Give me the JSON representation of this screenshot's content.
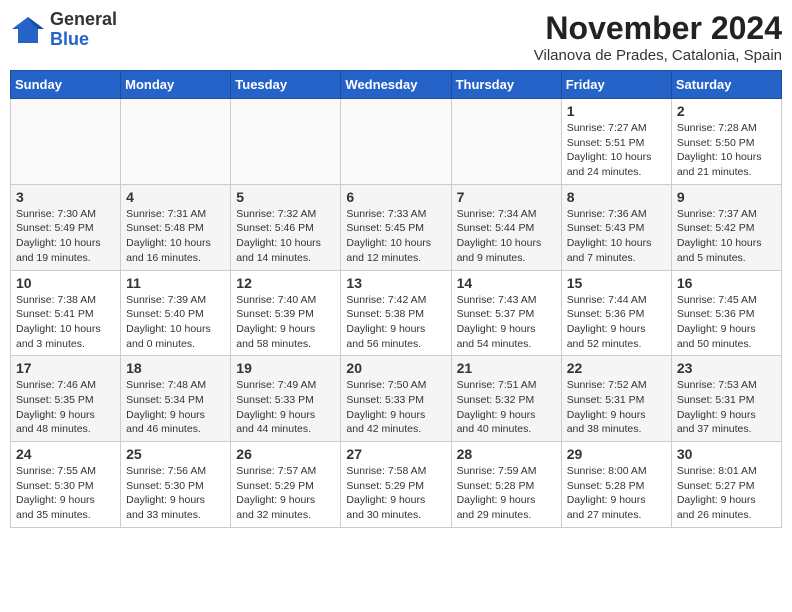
{
  "header": {
    "logo_general": "General",
    "logo_blue": "Blue",
    "month_title": "November 2024",
    "location": "Vilanova de Prades, Catalonia, Spain"
  },
  "days_of_week": [
    "Sunday",
    "Monday",
    "Tuesday",
    "Wednesday",
    "Thursday",
    "Friday",
    "Saturday"
  ],
  "weeks": [
    {
      "days": [
        {
          "date": "",
          "info": ""
        },
        {
          "date": "",
          "info": ""
        },
        {
          "date": "",
          "info": ""
        },
        {
          "date": "",
          "info": ""
        },
        {
          "date": "",
          "info": ""
        },
        {
          "date": "1",
          "info": "Sunrise: 7:27 AM\nSunset: 5:51 PM\nDaylight: 10 hours\nand 24 minutes."
        },
        {
          "date": "2",
          "info": "Sunrise: 7:28 AM\nSunset: 5:50 PM\nDaylight: 10 hours\nand 21 minutes."
        }
      ]
    },
    {
      "days": [
        {
          "date": "3",
          "info": "Sunrise: 7:30 AM\nSunset: 5:49 PM\nDaylight: 10 hours\nand 19 minutes."
        },
        {
          "date": "4",
          "info": "Sunrise: 7:31 AM\nSunset: 5:48 PM\nDaylight: 10 hours\nand 16 minutes."
        },
        {
          "date": "5",
          "info": "Sunrise: 7:32 AM\nSunset: 5:46 PM\nDaylight: 10 hours\nand 14 minutes."
        },
        {
          "date": "6",
          "info": "Sunrise: 7:33 AM\nSunset: 5:45 PM\nDaylight: 10 hours\nand 12 minutes."
        },
        {
          "date": "7",
          "info": "Sunrise: 7:34 AM\nSunset: 5:44 PM\nDaylight: 10 hours\nand 9 minutes."
        },
        {
          "date": "8",
          "info": "Sunrise: 7:36 AM\nSunset: 5:43 PM\nDaylight: 10 hours\nand 7 minutes."
        },
        {
          "date": "9",
          "info": "Sunrise: 7:37 AM\nSunset: 5:42 PM\nDaylight: 10 hours\nand 5 minutes."
        }
      ]
    },
    {
      "days": [
        {
          "date": "10",
          "info": "Sunrise: 7:38 AM\nSunset: 5:41 PM\nDaylight: 10 hours\nand 3 minutes."
        },
        {
          "date": "11",
          "info": "Sunrise: 7:39 AM\nSunset: 5:40 PM\nDaylight: 10 hours\nand 0 minutes."
        },
        {
          "date": "12",
          "info": "Sunrise: 7:40 AM\nSunset: 5:39 PM\nDaylight: 9 hours\nand 58 minutes."
        },
        {
          "date": "13",
          "info": "Sunrise: 7:42 AM\nSunset: 5:38 PM\nDaylight: 9 hours\nand 56 minutes."
        },
        {
          "date": "14",
          "info": "Sunrise: 7:43 AM\nSunset: 5:37 PM\nDaylight: 9 hours\nand 54 minutes."
        },
        {
          "date": "15",
          "info": "Sunrise: 7:44 AM\nSunset: 5:36 PM\nDaylight: 9 hours\nand 52 minutes."
        },
        {
          "date": "16",
          "info": "Sunrise: 7:45 AM\nSunset: 5:36 PM\nDaylight: 9 hours\nand 50 minutes."
        }
      ]
    },
    {
      "days": [
        {
          "date": "17",
          "info": "Sunrise: 7:46 AM\nSunset: 5:35 PM\nDaylight: 9 hours\nand 48 minutes."
        },
        {
          "date": "18",
          "info": "Sunrise: 7:48 AM\nSunset: 5:34 PM\nDaylight: 9 hours\nand 46 minutes."
        },
        {
          "date": "19",
          "info": "Sunrise: 7:49 AM\nSunset: 5:33 PM\nDaylight: 9 hours\nand 44 minutes."
        },
        {
          "date": "20",
          "info": "Sunrise: 7:50 AM\nSunset: 5:33 PM\nDaylight: 9 hours\nand 42 minutes."
        },
        {
          "date": "21",
          "info": "Sunrise: 7:51 AM\nSunset: 5:32 PM\nDaylight: 9 hours\nand 40 minutes."
        },
        {
          "date": "22",
          "info": "Sunrise: 7:52 AM\nSunset: 5:31 PM\nDaylight: 9 hours\nand 38 minutes."
        },
        {
          "date": "23",
          "info": "Sunrise: 7:53 AM\nSunset: 5:31 PM\nDaylight: 9 hours\nand 37 minutes."
        }
      ]
    },
    {
      "days": [
        {
          "date": "24",
          "info": "Sunrise: 7:55 AM\nSunset: 5:30 PM\nDaylight: 9 hours\nand 35 minutes."
        },
        {
          "date": "25",
          "info": "Sunrise: 7:56 AM\nSunset: 5:30 PM\nDaylight: 9 hours\nand 33 minutes."
        },
        {
          "date": "26",
          "info": "Sunrise: 7:57 AM\nSunset: 5:29 PM\nDaylight: 9 hours\nand 32 minutes."
        },
        {
          "date": "27",
          "info": "Sunrise: 7:58 AM\nSunset: 5:29 PM\nDaylight: 9 hours\nand 30 minutes."
        },
        {
          "date": "28",
          "info": "Sunrise: 7:59 AM\nSunset: 5:28 PM\nDaylight: 9 hours\nand 29 minutes."
        },
        {
          "date": "29",
          "info": "Sunrise: 8:00 AM\nSunset: 5:28 PM\nDaylight: 9 hours\nand 27 minutes."
        },
        {
          "date": "30",
          "info": "Sunrise: 8:01 AM\nSunset: 5:27 PM\nDaylight: 9 hours\nand 26 minutes."
        }
      ]
    }
  ]
}
